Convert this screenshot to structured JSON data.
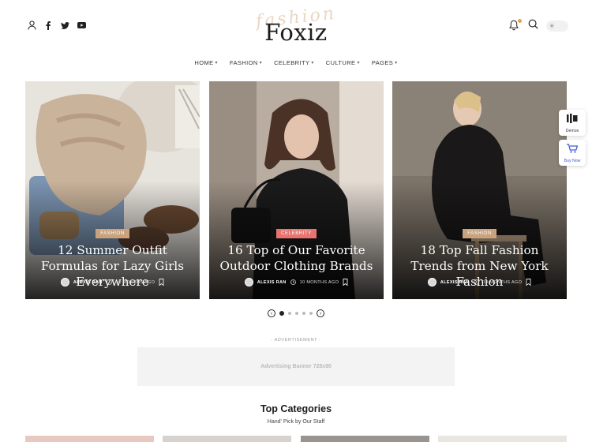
{
  "header": {
    "social_icons": [
      "user-icon",
      "facebook-icon",
      "twitter-icon",
      "youtube-icon"
    ],
    "logo_script": "fashion",
    "logo_text": "Foxiz",
    "right_icons": [
      "bell-icon",
      "search-icon",
      "sun-icon"
    ]
  },
  "nav": {
    "items": [
      {
        "label": "HOME"
      },
      {
        "label": "FASHION"
      },
      {
        "label": "CELEBRITY"
      },
      {
        "label": "CULTURE"
      },
      {
        "label": "PAGES"
      }
    ]
  },
  "slides": [
    {
      "category": "FASHION",
      "category_color": "#c9a27e",
      "title": "12 Summer Outfit Formulas for Lazy Girls Everywhere",
      "author": "ALEXIS RAN",
      "time": "10 MONTHS AGO"
    },
    {
      "category": "CELEBRITY",
      "category_color": "#e8736f",
      "title": "16 Top of Our Favorite Outdoor Clothing Brands",
      "author": "ALEXIS RAN",
      "time": "10 MONTHS AGO"
    },
    {
      "category": "FASHION",
      "category_color": "#c9a27e",
      "title": "18 Top Fall Fashion Trends from New York Fashion",
      "author": "ALEXIS RAN",
      "time": "10 MONTHS AGO"
    }
  ],
  "pager": {
    "count": 5,
    "active_index": 0
  },
  "advertisement": {
    "label": "- ADVERTISEMENT -",
    "banner_text": "Advertising Banner 728x90"
  },
  "categories": {
    "title": "Top Categories",
    "subtitle": "Hand' Pick by Our Staff"
  },
  "floating": {
    "demos_label": "Demos",
    "buy_label": "Buy Now"
  },
  "colors": {
    "accent_fashion": "#c9a27e",
    "accent_celebrity": "#e8736f",
    "buy_blue": "#3a5bd9"
  }
}
